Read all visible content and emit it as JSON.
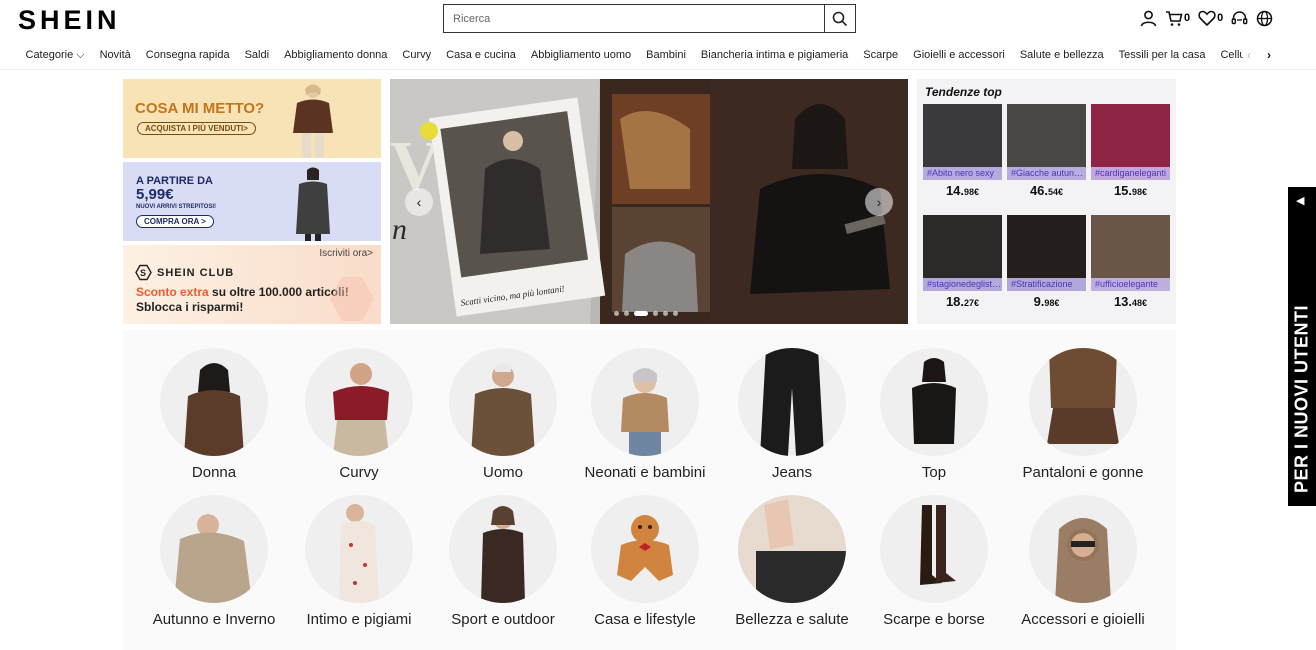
{
  "header": {
    "logo": "SHEIN",
    "search_placeholder": "Ricerca",
    "cart_count": "0",
    "wishlist_count": "0"
  },
  "nav": {
    "items": [
      "Categorie",
      "Novità",
      "Consegna rapida",
      "Saldi",
      "Abbigliamento donna",
      "Curvy",
      "Casa e cucina",
      "Abbigliamento uomo",
      "Bambini",
      "Biancheria intima e pigiameria",
      "Scarpe",
      "Gioielli e accessori",
      "Salute e bellezza",
      "Tessili per la casa",
      "Cellulari & accessori"
    ]
  },
  "promos": {
    "p1_title": "COSA MI METTO?",
    "p1_cta": "ACQUISTA I PIÙ VENDUTI>",
    "p2_title": "A PARTIRE DA",
    "p2_price": "5,99€",
    "p2_sub": "NUOVI ARRIVI STREPITOSI!",
    "p2_cta": "COMPRA ORA >",
    "p3_top": "Iscriviti ora>",
    "p3_club": "SHEIN  CLUB",
    "p3_line1_a": "Sconto extra",
    "p3_line1_b": " su oltre 100.000 articoli!",
    "p3_line2": "Sblocca i risparmi!"
  },
  "hero": {
    "caption": "Scatti vicino, ma più lontani!"
  },
  "trending": {
    "title": "Tendenze top",
    "items": [
      {
        "tag": "#Abito nero sexy",
        "price_int": "14.",
        "price_dec": "98€"
      },
      {
        "tag": "#Giacche autunnali",
        "price_int": "46.",
        "price_dec": "54€"
      },
      {
        "tag": "#cardiganeleganti",
        "price_int": "15.",
        "price_dec": "98€"
      },
      {
        "tag": "#stagionedeglistivali",
        "price_int": "18.",
        "price_dec": "27€"
      },
      {
        "tag": "#Stratificazione",
        "price_int": "9.",
        "price_dec": "98€"
      },
      {
        "tag": "#ufficioelegante",
        "price_int": "13.",
        "price_dec": "48€"
      }
    ]
  },
  "categories": [
    "Donna",
    "Curvy",
    "Uomo",
    "Neonati e bambini",
    "Jeans",
    "Top",
    "Pantaloni e gonne",
    "Autunno e Inverno",
    "Intimo e pigiami",
    "Sport e outdoor",
    "Casa e lifestyle",
    "Bellezza e salute",
    "Scarpe e  borse",
    "Accessori e gioielli"
  ],
  "side_tab": {
    "text": "PER I NUOVI UTENTI"
  },
  "colors": {
    "promo1_bg": "#f8e3b6",
    "promo2_bg": "#d9dcf5",
    "promo_accent_orange": "#ef5b2a",
    "trend_tag": "#4a35b8"
  }
}
